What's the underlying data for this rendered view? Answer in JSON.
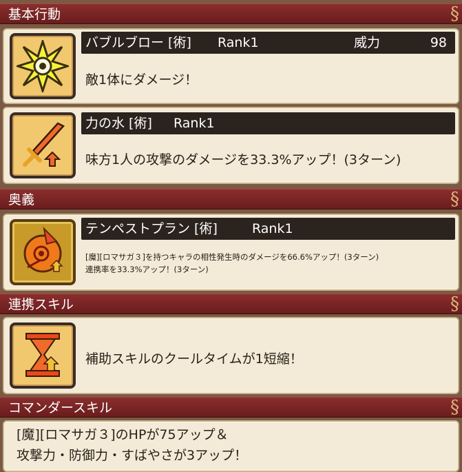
{
  "sections": {
    "basic": "基本行動",
    "ougi": "奥義",
    "renkei": "連携スキル",
    "commander": "コマンダースキル"
  },
  "skills": [
    {
      "name": "バブルブロー [術]",
      "rank": "Rank1",
      "power_label": "威力",
      "power_value": "98",
      "icon": "burst-star-icon",
      "desc": "敵1体にダメージ！"
    },
    {
      "name": "力の水 [術]",
      "rank": "Rank1",
      "icon": "sword-up-icon",
      "desc": "味方1人の攻撃のダメージを33.3%アップ！(3ターン)"
    }
  ],
  "ougi": {
    "name": "テンペストプラン [術]",
    "rank": "Rank1",
    "icon": "tempest-emblem-icon",
    "desc1": "[魔][ロマサガ３]を持つキャラの相性発生時のダメージを66.6%アップ！(3ターン)",
    "desc2": "連携率を33.3%アップ！(3ターン)"
  },
  "renkei": {
    "icon": "hourglass-up-icon",
    "desc": "補助スキルのクールタイムが1短縮！"
  },
  "commander": {
    "line1": "[魔][ロマサガ３]のHPが75アップ＆",
    "line2": "攻撃力・防御力・すばやさが3アップ！"
  },
  "colors": {
    "header": "#7a2424",
    "card": "#f3ebd8",
    "namebar": "#2b231e",
    "background": "#7a5a45"
  }
}
